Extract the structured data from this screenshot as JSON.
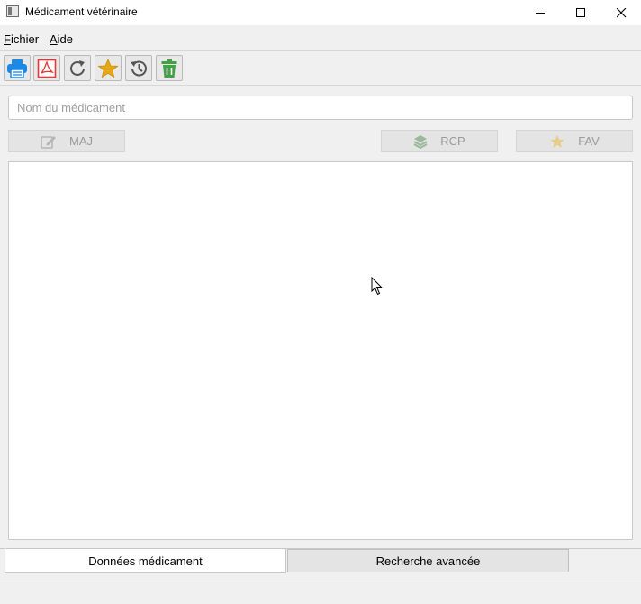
{
  "window": {
    "title": "Médicament vétérinaire"
  },
  "menu": [
    {
      "label": "Fichier"
    },
    {
      "label": "Aide"
    }
  ],
  "toolbar": [
    {
      "icon": "printer-icon",
      "color": "#1e88e5"
    },
    {
      "icon": "pdf-icon",
      "color": "#e53935"
    },
    {
      "icon": "refresh-icon",
      "color": "#555555"
    },
    {
      "icon": "star-icon",
      "color": "#e6a817"
    },
    {
      "icon": "history-icon",
      "color": "#555555"
    },
    {
      "icon": "trash-icon",
      "color": "#43a047"
    }
  ],
  "search": {
    "placeholder": "Nom du médicament",
    "value": ""
  },
  "actions": {
    "update_label": "MAJ",
    "rcp_label": "RCP",
    "fav_label": "FAV"
  },
  "tabs": [
    {
      "label": "Données médicament",
      "active": true
    },
    {
      "label": "Recherche avancée",
      "active": false
    }
  ]
}
